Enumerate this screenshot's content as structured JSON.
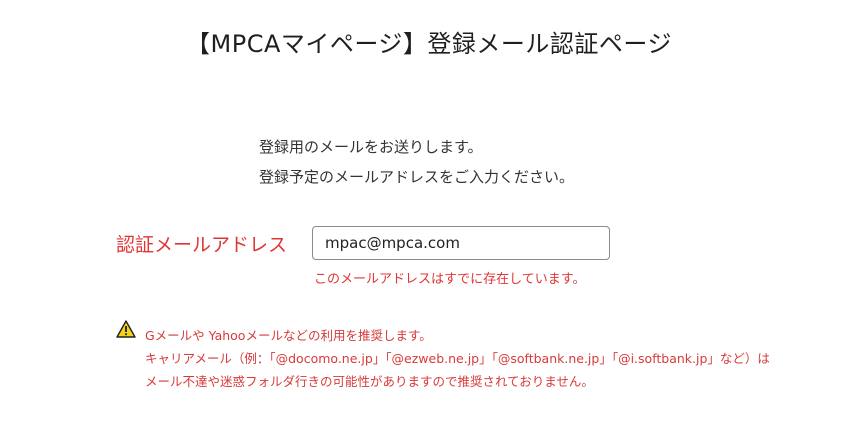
{
  "page": {
    "title": "【MPCAマイページ】登録メール認証ページ"
  },
  "intro": {
    "line1": "登録用のメールをお送りします。",
    "line2": "登録予定のメールアドレスをご入力ください。"
  },
  "form": {
    "email_label": "認証メールアドレス",
    "email_value": "mpac@mpca.com",
    "error_message": "このメールアドレスはすでに存在しています。"
  },
  "notice": {
    "icon": "warning-icon",
    "line1": "Gメールや Yahooメールなどの利用を推奨します。",
    "line2": "キャリアメール（例：「@docomo.ne.jp」「@ezweb.ne.jp」「@softbank.ne.jp」「@i.softbank.jp」など）は",
    "line3": "メール不達や迷惑フォルダ行きの可能性がありますので推奨されておりません。"
  },
  "colors": {
    "error": "#e03535",
    "warning_fill": "#f2d21b",
    "text": "#333333"
  }
}
